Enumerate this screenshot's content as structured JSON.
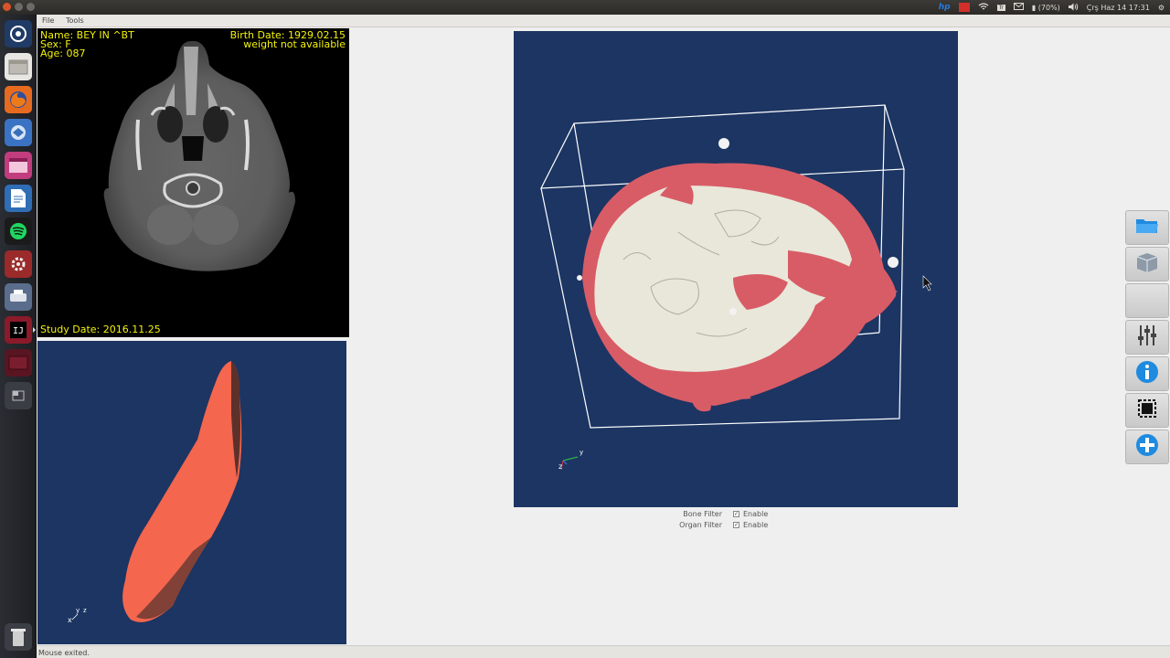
{
  "menu": {
    "items": [
      "File",
      "Tools"
    ]
  },
  "indicators": {
    "hp": "hp",
    "keyboard": "Tr",
    "battery": "(70%)",
    "clock": "Çrş Haz 14 17:31"
  },
  "patient": {
    "name": "Name: BEY IN ^BT",
    "sex": "Sex: F",
    "age": "Age: 087",
    "birth_date": "Birth Date: 1929.02.15",
    "weight": "weight not available",
    "study_date": "Study Date: 2016.11.25"
  },
  "filters": {
    "bone_label": "Bone Filter",
    "organ_label": "Organ Filter",
    "enable_label": "Enable",
    "bone_enabled": true,
    "organ_enabled": true
  },
  "status": {
    "text": "Mouse exited."
  },
  "toolbar": {
    "buttons": [
      "open-folder-icon",
      "3d-box-icon",
      "blank-icon",
      "sliders-icon",
      "info-icon",
      "crop-icon",
      "add-icon"
    ]
  },
  "axes": {
    "x": "x",
    "y": "y",
    "z": "z"
  },
  "colors": {
    "viewport_bg": "#1c3563",
    "organ": "#f4664e",
    "bone": "#e9e7da",
    "tissue": "#d85c66",
    "overlay_text": "#f2f20a"
  }
}
